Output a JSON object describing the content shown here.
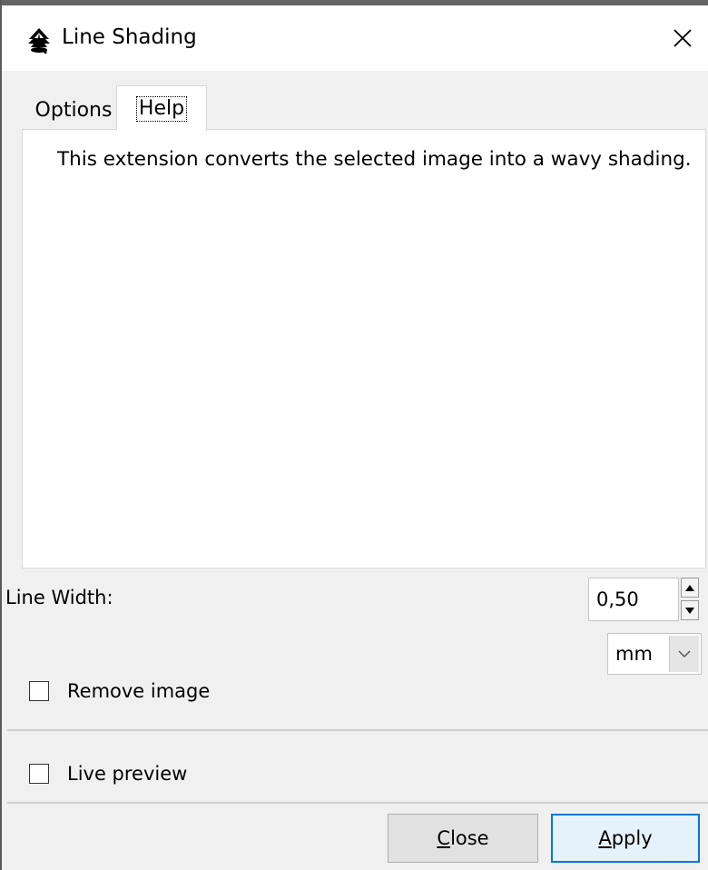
{
  "window": {
    "title": "Line Shading",
    "close_icon": "close-x-icon",
    "app_icon": "inkscape-icon"
  },
  "tabs": [
    {
      "label": "Options",
      "selected": false
    },
    {
      "label": "Help",
      "selected": true
    }
  ],
  "help": {
    "text": "This extension converts the selected image into a wavy shading."
  },
  "line_width": {
    "label": "Line Width:",
    "value": "0,50",
    "unit": "mm"
  },
  "remove_image": {
    "label": "Remove image",
    "checked": false
  },
  "live_preview": {
    "label": "Live preview",
    "checked": false
  },
  "buttons": {
    "close": "Close",
    "apply": "Apply"
  },
  "colors": {
    "accent": "#0078d7",
    "background": "#f0f0f0"
  }
}
